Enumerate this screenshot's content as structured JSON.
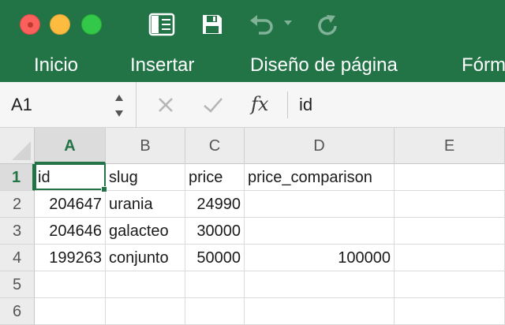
{
  "window": {
    "traffic_lights": [
      "close-button",
      "minimize-button",
      "zoom-button"
    ]
  },
  "toolbar": {
    "icons": [
      "sidebar-toggle-icon",
      "save-icon",
      "undo-icon",
      "undo-dropdown-icon",
      "redo-icon"
    ]
  },
  "ribbon": {
    "tabs": [
      "Inicio",
      "Insertar",
      "Diseño de página",
      "Fórm"
    ]
  },
  "formula_bar": {
    "name_box": "A1",
    "fx_label": "fx",
    "content": "id"
  },
  "sheet": {
    "columns": [
      "A",
      "B",
      "C",
      "D",
      "E"
    ],
    "selected_column": "A",
    "rows": [
      "1",
      "2",
      "3",
      "4",
      "5",
      "6"
    ],
    "selected_row": "1",
    "active_cell": "A1",
    "cells": [
      [
        "id",
        "slug",
        "price",
        "price_comparison",
        ""
      ],
      [
        "204647",
        "urania",
        "24990",
        "",
        ""
      ],
      [
        "204646",
        "galacteo",
        "30000",
        "",
        ""
      ],
      [
        "199263",
        "conjunto",
        "50000",
        "100000",
        ""
      ],
      [
        "",
        "",
        "",
        "",
        ""
      ],
      [
        "",
        "",
        "",
        "",
        ""
      ]
    ]
  },
  "colors": {
    "accent": "#227447",
    "grid_line": "#dadada",
    "header_bg": "#ececec"
  }
}
